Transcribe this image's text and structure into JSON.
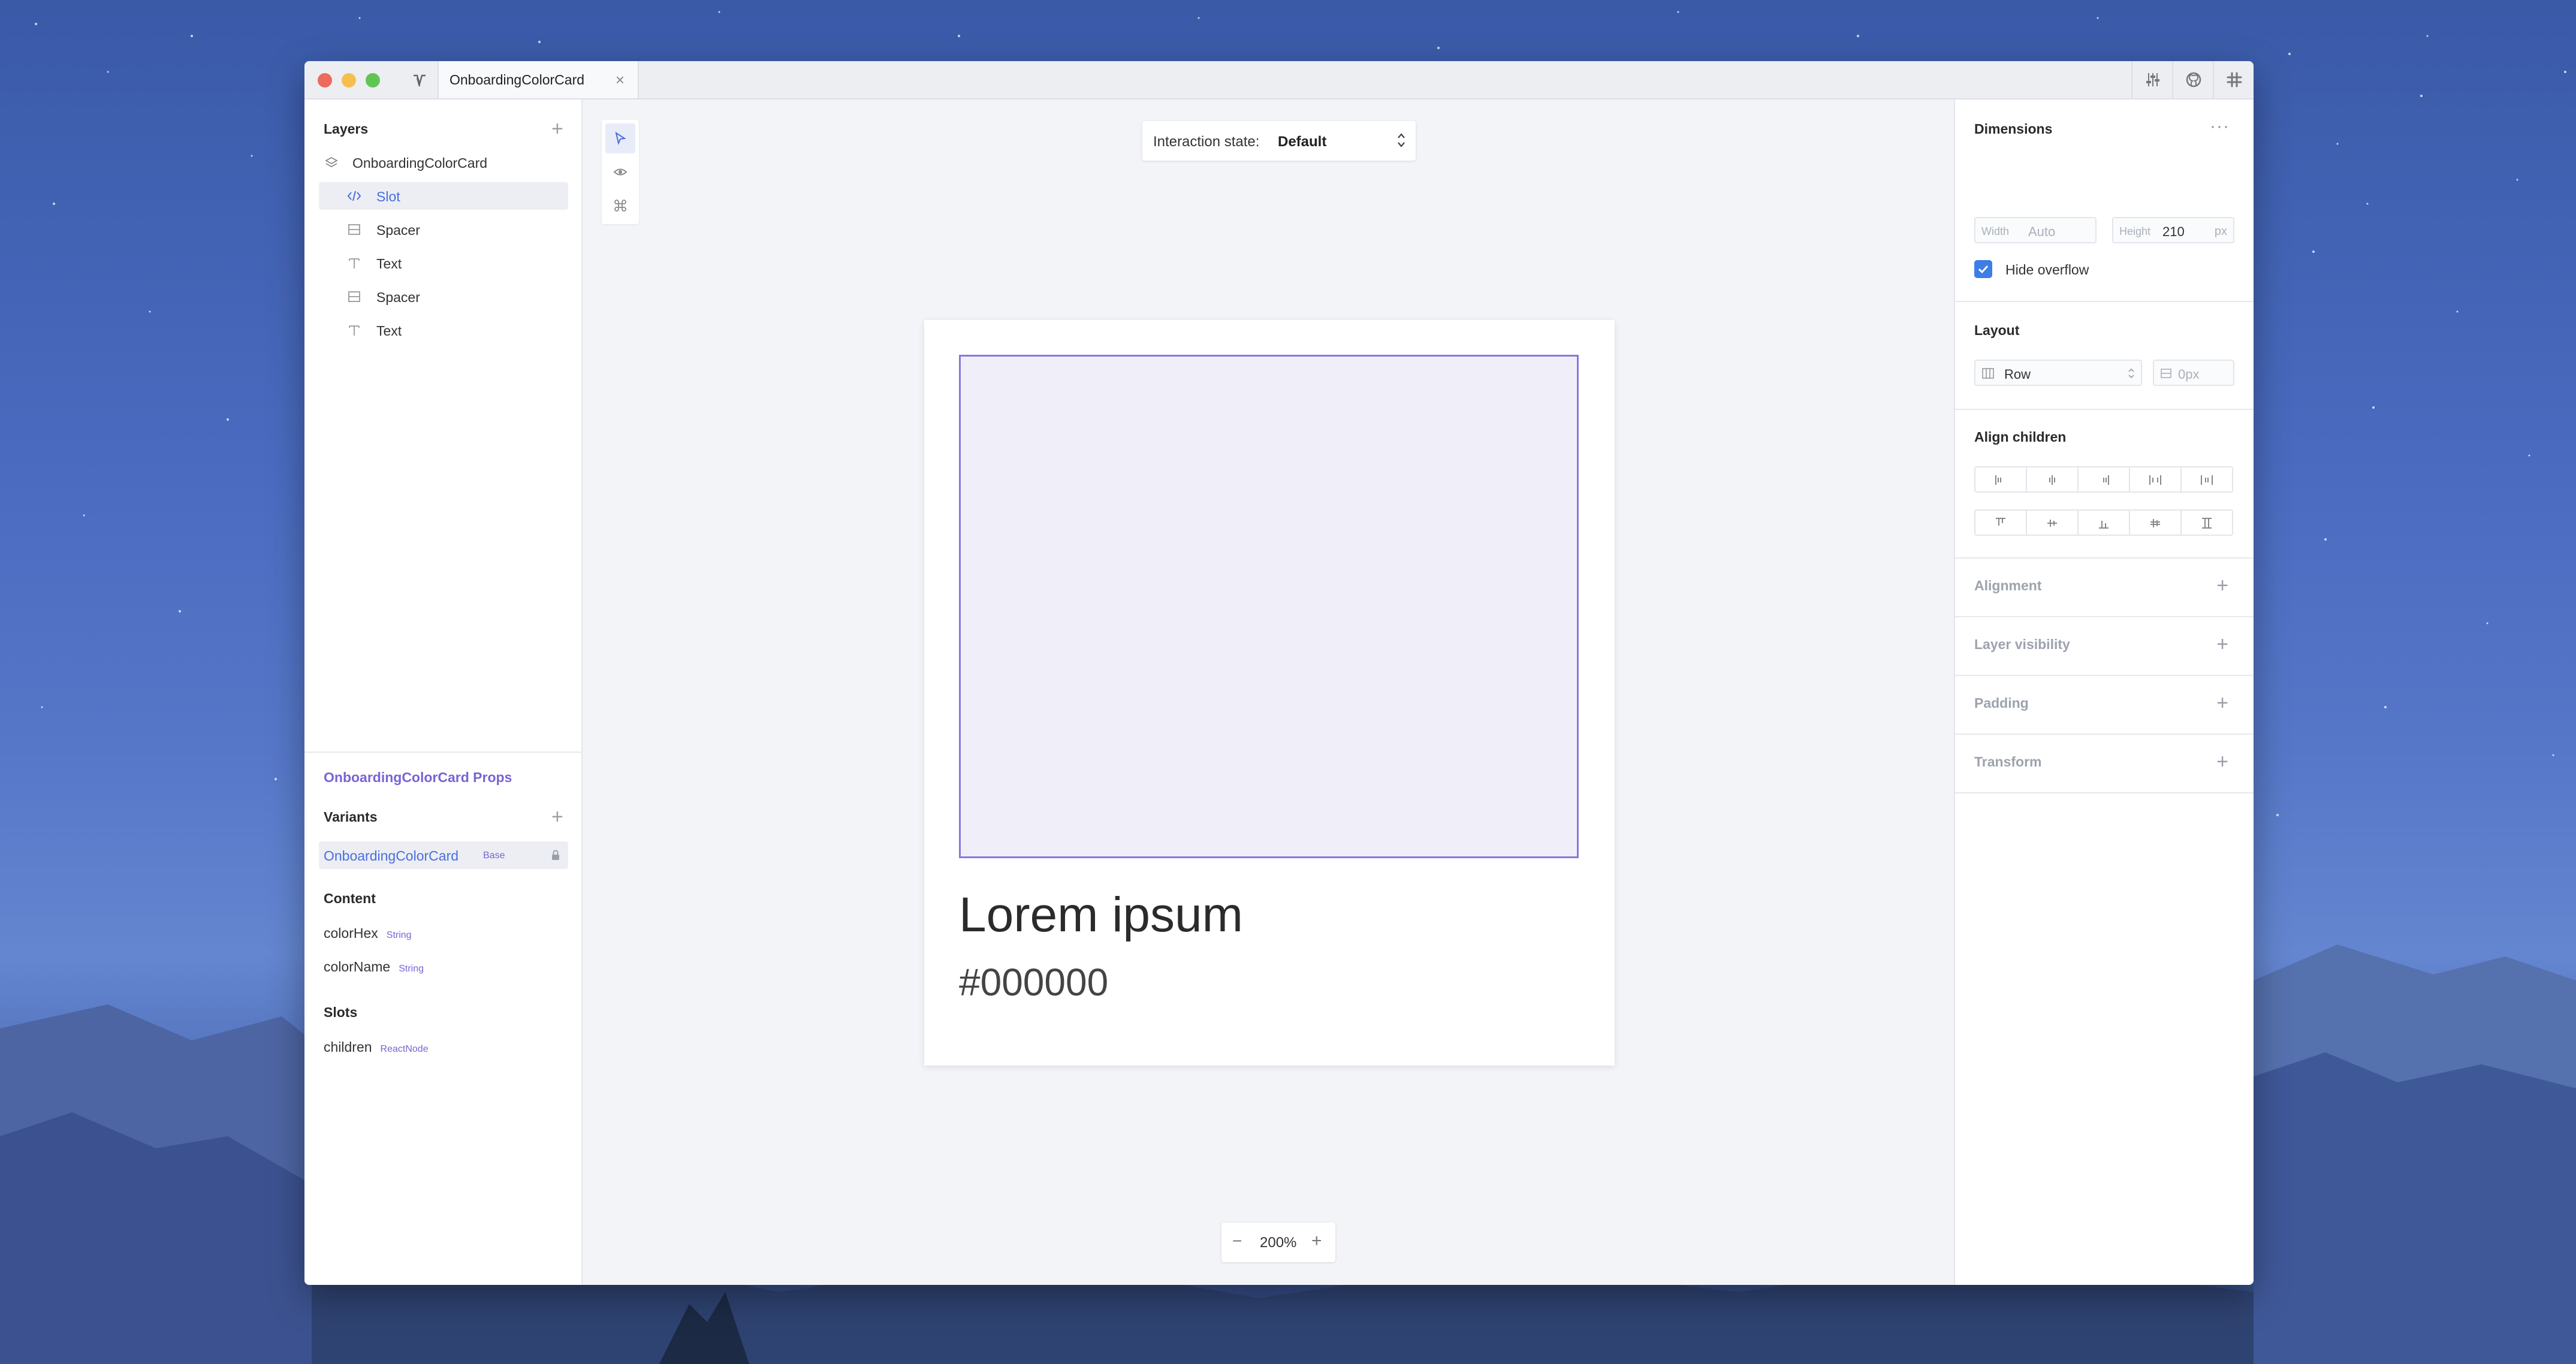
{
  "window": {
    "tab_title": "OnboardingColorCard",
    "tab_close": "×"
  },
  "layers": {
    "heading": "Layers",
    "items": [
      {
        "label": "OnboardingColorCard",
        "icon": "layers-icon"
      },
      {
        "label": "Slot",
        "icon": "code-icon",
        "selected": true
      },
      {
        "label": "Spacer",
        "icon": "spacer-icon"
      },
      {
        "label": "Text",
        "icon": "text-icon"
      },
      {
        "label": "Spacer",
        "icon": "spacer-icon"
      },
      {
        "label": "Text",
        "icon": "text-icon"
      }
    ]
  },
  "props": {
    "title": "OnboardingColorCard Props",
    "variants_heading": "Variants",
    "variant": {
      "label": "OnboardingColorCard",
      "tag": "Base"
    },
    "content_heading": "Content",
    "content": [
      {
        "name": "colorHex",
        "type": "String"
      },
      {
        "name": "colorName",
        "type": "String"
      }
    ],
    "slots_heading": "Slots",
    "slots": [
      {
        "name": "children",
        "type": "ReactNode"
      }
    ]
  },
  "canvas": {
    "interaction_label": "Interaction state:",
    "interaction_value": "Default",
    "card_title": "Lorem ipsum",
    "card_hex": "#000000",
    "zoom_minus": "−",
    "zoom": "200%",
    "zoom_plus": "+"
  },
  "inspector": {
    "dimensions_heading": "Dimensions",
    "more": "···",
    "width_label": "Width",
    "width_value": "Auto",
    "height_label": "Height",
    "height_value": "210",
    "height_unit": "px",
    "hide_overflow": "Hide overflow",
    "hide_overflow_checked": true,
    "layout_heading": "Layout",
    "layout_direction": "Row",
    "layout_gap": "0px",
    "align_heading": "Align children",
    "collapsed_sections": [
      "Alignment",
      "Layer visibility",
      "Padding",
      "Transform"
    ]
  },
  "colors": {
    "accent_blue": "#4a6ee0",
    "accent_purple": "#7a63d6",
    "checkbox_blue": "#3d7de6",
    "slot_border": "#8a76df",
    "slot_fill": "#f0eff9"
  }
}
